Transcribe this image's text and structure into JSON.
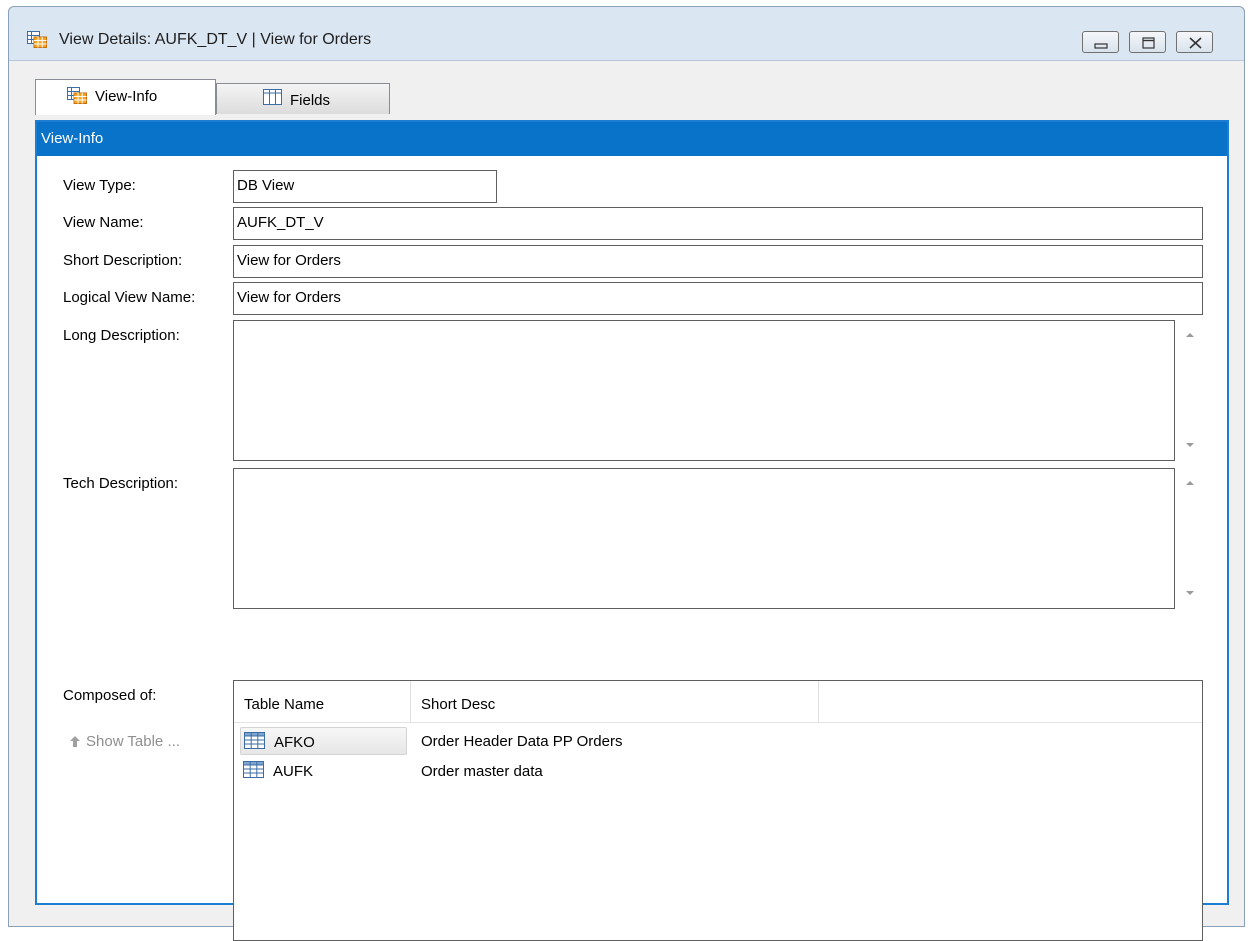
{
  "window": {
    "title": "View Details: AUFK_DT_V | View for Orders",
    "buttons": [
      "minimize",
      "maximize",
      "close"
    ]
  },
  "tabs": [
    {
      "label": "View-Info",
      "icon": "view-table-icon",
      "active": true
    },
    {
      "label": "Fields",
      "icon": "columns-icon",
      "active": false
    }
  ],
  "panel": {
    "header": "View-Info"
  },
  "form": {
    "view_type": {
      "label": "View Type:",
      "value": "DB View"
    },
    "view_name": {
      "label": "View Name:",
      "value": "AUFK_DT_V"
    },
    "short_desc": {
      "label": "Short Description:",
      "value": "View for Orders"
    },
    "logical_name": {
      "label": "Logical View Name:",
      "value": "View for Orders"
    },
    "long_desc": {
      "label": "Long Description:",
      "value": ""
    },
    "tech_desc": {
      "label": "Tech Description:",
      "value": ""
    }
  },
  "composed": {
    "label": "Composed of:",
    "show_table_label": "Show Table ...",
    "columns": [
      "Table Name",
      "Short Desc"
    ],
    "rows": [
      {
        "name": "AFKO",
        "desc": "Order Header Data PP Orders",
        "selected": true
      },
      {
        "name": "AUFK",
        "desc": "Order master data",
        "selected": false
      }
    ]
  },
  "colors": {
    "accent": "#0873c8",
    "panel_border": "#1c7dd1",
    "window_frame": "#dbe6f3",
    "disabled_text": "#8f8f8f"
  }
}
